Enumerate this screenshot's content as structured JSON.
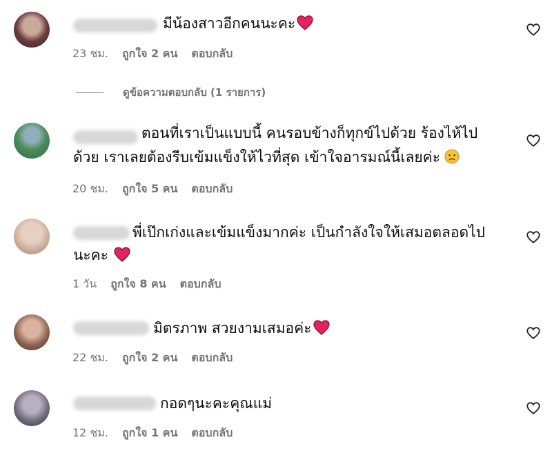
{
  "comments": [
    {
      "text": "มีน้องสาวอีกคนนะคะ",
      "time": "23 ชม.",
      "likes": "ถูกใจ 2 คน",
      "reply": "ตอบกลับ",
      "emoji": "red-heart"
    },
    {
      "text_line1": "ตอนที่เราเป็นแบบนี้ คนรอบข้างก็ทุกข์ไปด้วย ร้องไห้ไป",
      "text_line2": "ด้วย เราเลยต้องรีบเข้มแข็งให้ไวที่สุด เข้าใจอารมณ์นี้เลยค่ะ",
      "time": "20 ชม.",
      "likes": "ถูกใจ 5 คน",
      "reply": "ตอบกลับ",
      "emoji": "sad-face"
    },
    {
      "text_line1": "พี่เป๊กเก่งและเข้มแข็งมากค่ะ เป็นกำลังใจให้เสมอตลอดไป",
      "text_line2": "นะคะ",
      "time": "1 วัน",
      "likes": "ถูกใจ 8 คน",
      "reply": "ตอบกลับ",
      "emoji": "red-heart"
    },
    {
      "text": "มิตรภาพ สวยงามเสมอค่ะ",
      "time": "22 ชม.",
      "likes": "ถูกใจ 2 คน",
      "reply": "ตอบกลับ",
      "emoji": "red-heart"
    },
    {
      "text": "กอดๆนะคะคุณแม่",
      "time": "12 ชม.",
      "likes": "ถูกใจ 1 คน",
      "reply": "ตอบกลับ"
    }
  ],
  "view_replies": "ดูข้อความตอบกลับ (1 รายการ)",
  "colors": {
    "meta_text": "#737373",
    "heart_emoji": "#e0245e",
    "like_icon_stroke": "#262626"
  },
  "icons": {
    "like": "heart-outline-icon"
  }
}
